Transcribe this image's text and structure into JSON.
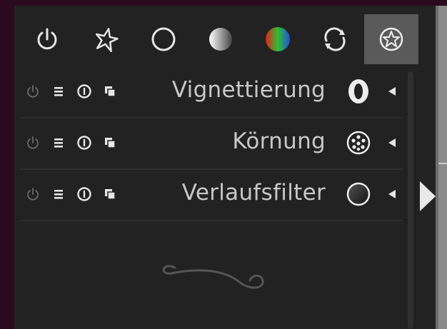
{
  "module_groups": [
    {
      "name": "active modules",
      "icon": "power-icon"
    },
    {
      "name": "favorites",
      "icon": "star-icon"
    },
    {
      "name": "basic",
      "icon": "circle-icon"
    },
    {
      "name": "tone",
      "icon": "gradient-circle-icon"
    },
    {
      "name": "color",
      "icon": "color-circle-icon"
    },
    {
      "name": "correct",
      "icon": "rotate-icon"
    },
    {
      "name": "effect",
      "icon": "effect-icon",
      "active": true
    }
  ],
  "modules": [
    {
      "title": "Vignettierung",
      "icon": "vignette-icon",
      "enabled": false
    },
    {
      "title": "Körnung",
      "icon": "grain-icon",
      "enabled": false
    },
    {
      "title": "Verlaufsfilter",
      "icon": "graduated-filter-icon",
      "enabled": false
    }
  ],
  "colors": {
    "panel": "#222222",
    "text": "#c8c8c8",
    "active_group": "#5a5a5a",
    "frame": "#2a0a1c"
  }
}
